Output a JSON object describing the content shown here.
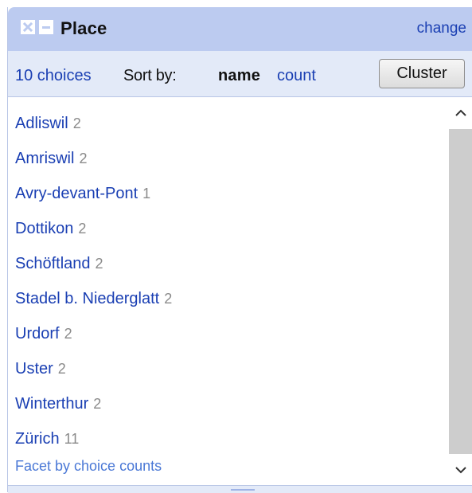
{
  "header": {
    "title": "Place",
    "change_label": "change",
    "close_icon": "close-icon",
    "minimize_icon": "minimize-icon"
  },
  "subheader": {
    "choices_label": "10 choices",
    "sortby_label": "Sort by:",
    "sort_name_label": "name",
    "sort_count_label": "count",
    "cluster_label": "Cluster"
  },
  "choices": [
    {
      "name": "Adliswil",
      "count": "2"
    },
    {
      "name": "Amriswil",
      "count": "2"
    },
    {
      "name": "Avry-devant-Pont",
      "count": "1"
    },
    {
      "name": "Dottikon",
      "count": "2"
    },
    {
      "name": "Schöftland",
      "count": "2"
    },
    {
      "name": "Stadel b. Niederglatt",
      "count": "2"
    },
    {
      "name": "Urdorf",
      "count": "2"
    },
    {
      "name": "Uster",
      "count": "2"
    },
    {
      "name": "Winterthur",
      "count": "2"
    },
    {
      "name": "Zürich",
      "count": "11"
    }
  ],
  "footer": {
    "facet_by_label": "Facet by choice counts"
  },
  "colors": {
    "header_bg": "#bccbf0",
    "subheader_bg": "#e3eaf8",
    "link": "#1a3fb3",
    "count": "#8a8a8a"
  }
}
